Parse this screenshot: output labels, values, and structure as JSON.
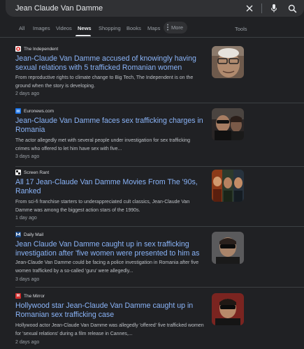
{
  "search": {
    "query": "Jean Claude Van Damme"
  },
  "tabs": [
    "All",
    "Images",
    "Videos",
    "News",
    "Shopping",
    "Books",
    "Maps"
  ],
  "more_label": "More",
  "tools_label": "Tools",
  "icons": {
    "clear": "close-icon",
    "voice": "microphone-icon",
    "search": "search-icon",
    "more": "dots-vertical-icon"
  },
  "colors": {
    "link": "#8ab4f8",
    "background": "#202124"
  },
  "results": [
    {
      "source": "The Independent",
      "favicon_text": "",
      "title": "Jean-Claude Van Damme accused of knowingly having sexual relations with 5 trafficked Romanian women",
      "snippet": "From reproductive rights to climate change to Big Tech, The Independent is on the ground when the story is developing.",
      "age": "2 days ago"
    },
    {
      "source": "Euronews.com",
      "favicon_text": "",
      "title": "Jean-Claude Van Damme faces sex trafficking charges in Romania",
      "snippet": "The actor allegedly met with several people under investigation for sex trafficking crimes who offered to let him have sex with five...",
      "age": "3 days ago"
    },
    {
      "source": "Screen Rant",
      "favicon_text": "",
      "title": "All 17 Jean-Claude Van Damme Movies From The '90s, Ranked",
      "snippet": "From sci-fi franchise starters to underappreciated cult classics, Jean-Claude Van Damme was among the biggest action stars of the 1990s.",
      "age": "1 day ago"
    },
    {
      "source": "Daily Mail",
      "favicon_text": "",
      "title": "Jean Claude Van Damme caught up in sex trafficking investigation after 'five women were presented to him as a",
      "snippet": "Jean-Claude Van Damme could be facing a police investigation in Romania after five women trafficked by a so-called 'guru' were allegedly...",
      "age": "3 days ago"
    },
    {
      "source": "The Mirror",
      "favicon_text": "M",
      "title": "Hollywood star Jean-Claude Van Damme caught up in Romanian sex trafficking case",
      "snippet": "Hollywood actor Jean-Claude Van Damme was allegedly 'offered' five trafficked women for 'sexual relations' during a film release in Cannes,...",
      "age": "2 days ago"
    }
  ]
}
